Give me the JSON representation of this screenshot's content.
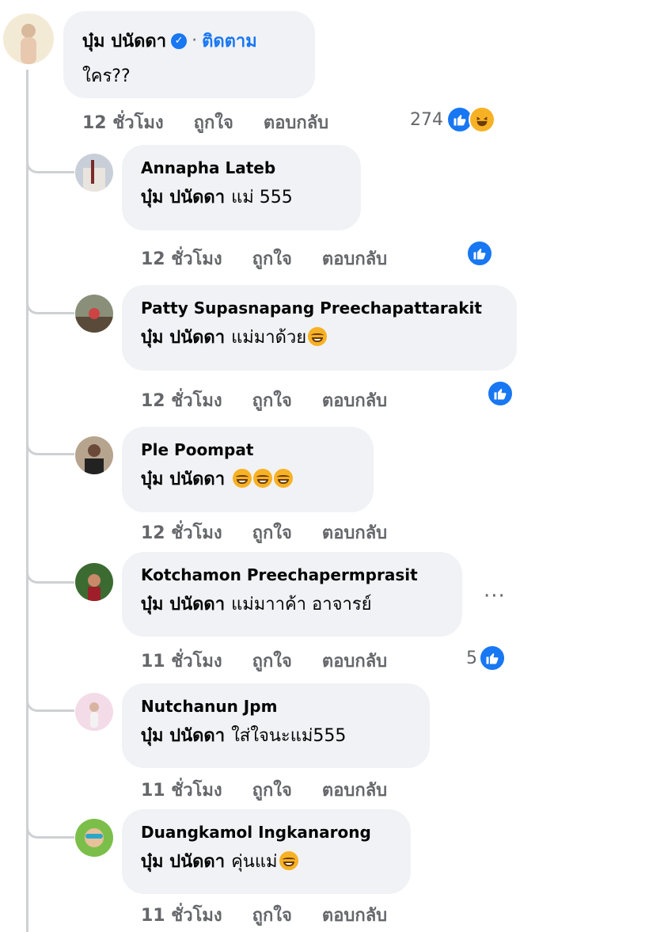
{
  "top_comment": {
    "author": "บุ๋ม ปนัดดา",
    "separator": "·",
    "follow_label": "ติดตาม",
    "text": "ใคร??",
    "time": "12 ชั่วโมง",
    "like_label": "ถูกใจ",
    "reply_label": "ตอบกลับ",
    "reaction_count": "274",
    "reactions": [
      "like-icon",
      "haha-icon"
    ]
  },
  "replies": [
    {
      "author": "Annapha Lateb",
      "tag": "บุ๋ม ปนัดดา",
      "text": "แม่ 555",
      "time": "12 ชั่วโมง",
      "like_label": "ถูกใจ",
      "reply_label": "ตอบกลับ",
      "reaction_count": "",
      "reaction": "like-icon"
    },
    {
      "author": "Patty Supasnapang Preechapattarakit",
      "tag": "บุ๋ม ปนัดดา",
      "text": "แม่มาด้วย",
      "time": "12 ชั่วโมง",
      "like_label": "ถูกใจ",
      "reply_label": "ตอบกลับ",
      "reaction_count": "",
      "reaction": "like-icon"
    },
    {
      "author": "Ple Poompat",
      "tag": "บุ๋ม ปนัดดา",
      "text": "",
      "time": "12 ชั่วโมง",
      "like_label": "ถูกใจ",
      "reply_label": "ตอบกลับ",
      "reaction_count": ""
    },
    {
      "author": "Kotchamon Preechapermprasit",
      "tag": "บุ๋ม ปนัดดา",
      "text": "แม่มาาค้า อาจารย์",
      "time": "11 ชั่วโมง",
      "like_label": "ถูกใจ",
      "reply_label": "ตอบกลับ",
      "reaction_count": "5",
      "reaction": "like-icon",
      "more_label": "···"
    },
    {
      "author": "Nutchanun Jpm",
      "tag": "บุ๋ม ปนัดดา",
      "text": "ใส่ใจนะแม่555",
      "time": "11 ชั่วโมง",
      "like_label": "ถูกใจ",
      "reply_label": "ตอบกลับ",
      "reaction_count": ""
    },
    {
      "author": "Duangkamol Ingkanarong",
      "tag": "บุ๋ม ปนัดดา",
      "text": "คุ่นแม่",
      "time": "11 ชั่วโมง",
      "like_label": "ถูกใจ",
      "reply_label": "ตอบกลับ",
      "reaction_count": ""
    }
  ],
  "colors": {
    "accent": "#1877f2",
    "bubble": "#f0f2f5",
    "muted": "#65676b",
    "haha": "#f7b125"
  }
}
